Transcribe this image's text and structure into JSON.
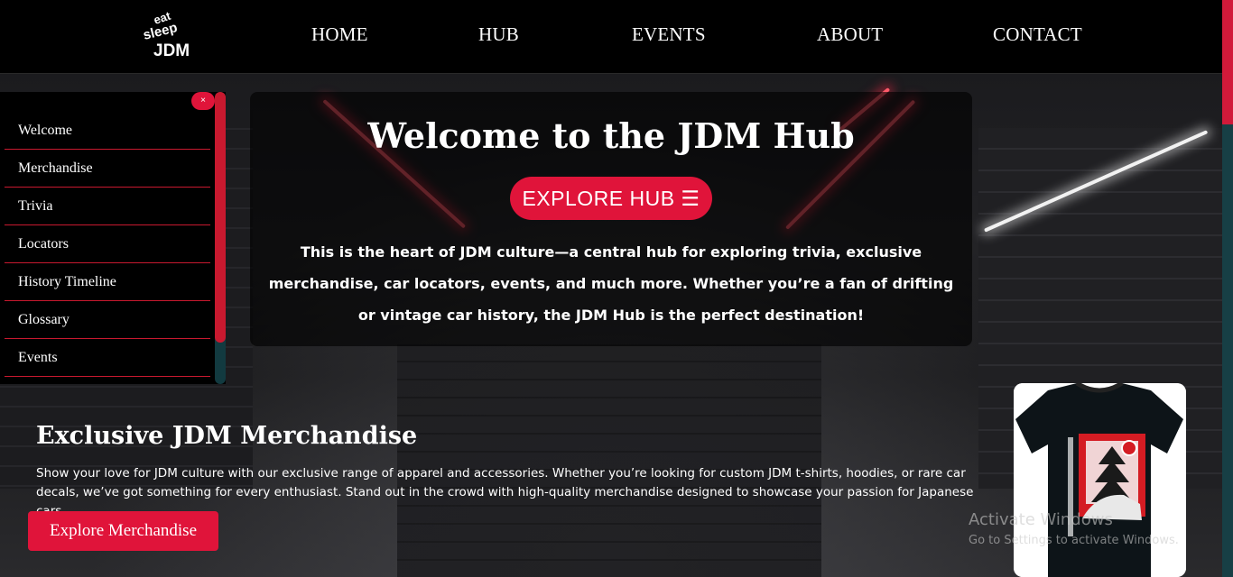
{
  "header": {
    "logo_text": [
      "eat",
      "sleep",
      "JDM"
    ],
    "nav": [
      "HOME",
      "HUB",
      "EVENTS",
      "ABOUT",
      "CONTACT"
    ]
  },
  "sidebar": {
    "close_label": "×",
    "items": [
      "Welcome",
      "Merchandise",
      "Trivia",
      "Locators",
      "History Timeline",
      "Glossary",
      "Events"
    ]
  },
  "hero": {
    "title": "Welcome to the JDM Hub",
    "button_label": "EXPLORE HUB ☰",
    "description": "This is the heart of JDM culture—a central hub for exploring trivia, exclusive merchandise, car locators, events, and much more. Whether you’re a fan of drifting or vintage car history, the JDM Hub is the perfect destination!"
  },
  "merch": {
    "title": "Exclusive JDM Merchandise",
    "text": "Show your love for JDM culture with our exclusive range of apparel and accessories. Whether you’re looking for custom JDM t-shirts, hoodies, or rare car decals, we’ve got something for every enthusiast. Stand out in the crowd with high-quality merchandise designed to showcase your passion for Japanese cars.",
    "button_label": "Explore Merchandise"
  },
  "watermark": {
    "title": "Activate Windows",
    "subtitle": "Go to Settings to activate Windows."
  },
  "colors": {
    "accent": "#e0143a",
    "header_bg": "#000000",
    "scrollbar_track": "#173f45"
  }
}
